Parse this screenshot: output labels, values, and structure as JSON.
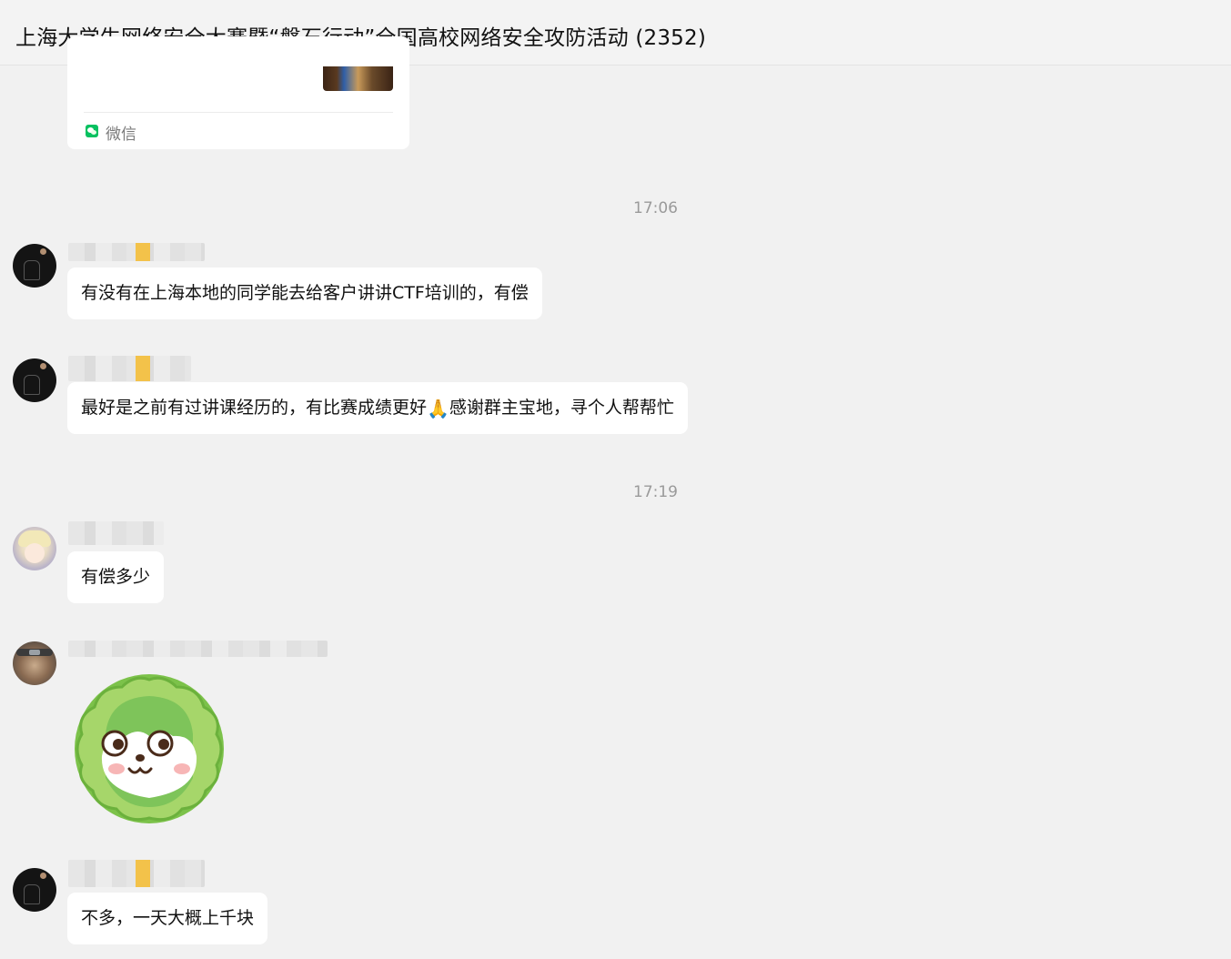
{
  "window": {
    "title": "上海大学生网络安全大赛暨“磐石行动”全国高校网络安全攻防活动 (2352)"
  },
  "shared_card": {
    "source_label": "微信",
    "source_icon": "wechat-icon"
  },
  "timestamps": [
    "17:06",
    "17:19"
  ],
  "messages": [
    {
      "sender_avatar": "dark-avatar",
      "text": "有没有在上海本地的同学能去给客户讲讲CTF培训的，有偿"
    },
    {
      "sender_avatar": "dark-avatar",
      "text_before": "最好是之前有过讲课经历的，有比赛成绩更好",
      "emoji": "🙏",
      "text_after": "感谢群主宝地，寻个人帮帮忙"
    },
    {
      "sender_avatar": "anime-avatar",
      "text": "有偿多少"
    },
    {
      "sender_avatar": "ninja-avatar",
      "sticker": "cabbage-dog-sticker"
    },
    {
      "sender_avatar": "dark-avatar",
      "text": "不多，一天大概上千块"
    }
  ],
  "colors": {
    "background": "#f1f1f1",
    "bubble": "#ffffff",
    "wechat_green": "#07c160",
    "timestamp": "#9a9a9a"
  }
}
